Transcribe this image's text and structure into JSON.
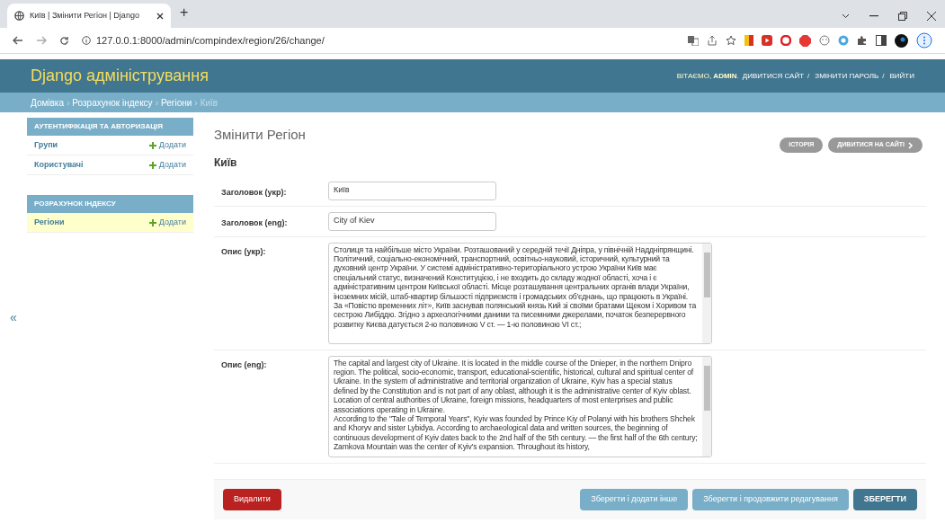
{
  "browser": {
    "tab_title": "Київ | Змінити Регіон | Django",
    "new_tab": "+",
    "address": "127.0.0.1:8000/admin/compindex/region/26/change/"
  },
  "header": {
    "title": "Django адміністрування",
    "welcome": "ВІТАЄМО, **ADMIN**.",
    "links": [
      "ДИВИТИСЯ САЙТ",
      "ЗМІНИТИ ПАРОЛЬ",
      "ВИЙТИ"
    ],
    "link_separator": "/"
  },
  "breadcrumbs": {
    "separator": "›",
    "items": [
      {
        "label": "Домівка",
        "link": true
      },
      {
        "label": "Розрахунок індексу",
        "link": true
      },
      {
        "label": "Регіони",
        "link": true
      },
      {
        "label": "Київ",
        "link": false
      }
    ]
  },
  "sidebar": {
    "modules": [
      {
        "caption": "АУТЕНТИФІКАЦІЯ ТА АВТОРИЗАЦІЯ",
        "rows": [
          {
            "label": "Групи",
            "add": "Додати",
            "selected": false
          },
          {
            "label": "Користувачі",
            "add": "Додати",
            "selected": false
          }
        ]
      },
      {
        "caption": "РОЗРАХУНОК ІНДЕКСУ",
        "rows": [
          {
            "label": "Регіони",
            "add": "Додати",
            "selected": true
          }
        ]
      }
    ],
    "toggle": "«"
  },
  "content": {
    "title": "Змінити Регіон",
    "object_name": "Київ",
    "object_tools": [
      "ІСТОРІЯ",
      "ДИВИТИСЯ НА САЙТІ"
    ],
    "fields": [
      {
        "kind": "input",
        "label": "Заголовок (укр):",
        "value": "Київ"
      },
      {
        "kind": "input",
        "label": "Заголовок (eng):",
        "value": "City of Kiev"
      },
      {
        "kind": "textarea",
        "label": "Опис (укр):",
        "value": "Столиця та найбільше місто України. Розташований у середній течії Дніпра, у північній Наддніпрянщині. Політичний, соціально-економічний, транспортний, освітньо-науковий, історичний, культурний та духовний центр України. У системі адміністративно-територіального устрою України Київ має спеціальний статус, визначений Конституцією, і не входить до складу жодної області, хоча і є адміністративним центром Київської області. Місце розташування центральних органів влади України, іноземних місій, штаб-квартир більшості підприємств і громадських об'єднань, що працюють в Україні.\nЗа «Повістю временних літ», Київ заснував полянський князь Кий зі своїми братами Щеком і Хоривом та сестрою Либіддю. Згідно з археологічними даними та писемними джерелами, початок безперервного розвитку Києва датується 2-ю половиною V ст. — 1-ю половиною VI ст.;"
      },
      {
        "kind": "textarea",
        "label": "Опис (eng):",
        "value": "The capital and largest city of Ukraine. It is located in the middle course of the Dnieper, in the northern Dnipro region. The political, socio-economic, transport, educational-scientific, historical, cultural and spiritual center of Ukraine. In the system of administrative and territorial organization of Ukraine, Kyiv has a special status defined by the Constitution and is not part of any oblast, although it is the administrative center of Kyiv oblast. Location of central authorities of Ukraine, foreign missions, headquarters of most enterprises and public associations operating in Ukraine.\nAccording to the \"Tale of Temporal Years\", Kyiv was founded by Prince Kiy of Polanyi with his brothers Shchek and Khoryv and sister Lybidya. According to archaeological data and written sources, the beginning of continuous development of Kyiv dates back to the 2nd half of the 5th century. — the first half of the 6th century; Zamkova Mountain was the center of Kyiv's expansion. Throughout its history,"
      }
    ],
    "submit": [
      {
        "kind": "delete",
        "label": "Видалити"
      },
      {
        "kind": "secondary",
        "label": "Зберегти і додати інше"
      },
      {
        "kind": "secondary",
        "label": "Зберегти і продовжити редагування"
      },
      {
        "kind": "default",
        "label": "ЗБЕРЕГТИ"
      }
    ]
  }
}
